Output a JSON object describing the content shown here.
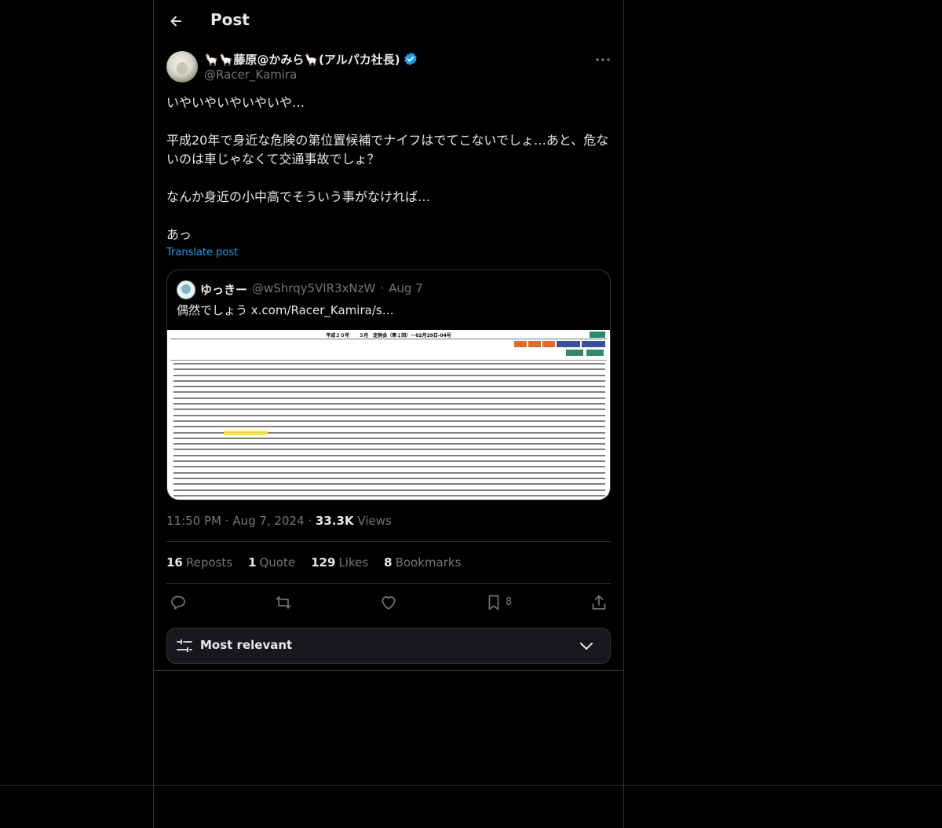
{
  "header": {
    "title": "Post"
  },
  "author": {
    "display_name": "🦙🦙藤原@かみら🦙(アルパカ社長)",
    "handle": "@Racer_Kamira",
    "verified": true
  },
  "tweet": {
    "text": "いやいやいやいやいや…\n\n平成20年で身近な危険の第位置候補でナイフはでてこないでしょ…あと、危ないのは車じゃなくて交通事故でしょ？\n\nなんか身近の小中高でそういう事がなければ…\n\nあっ",
    "translate_label": "Translate post"
  },
  "quote": {
    "name": "ゆっきー",
    "handle": "@wShrqy5VlR3xNzW",
    "separator": "·",
    "date": "Aug 7",
    "text": "偶然でしょう  x.com/Racer_Kamira/s…",
    "image": {
      "doc_title": "平成２０年　　３月　定例会（第１回）－02月29日-04号"
    }
  },
  "meta": {
    "time": "11:50 PM",
    "sep1": "·",
    "date": "Aug 7, 2024",
    "sep2": "·",
    "views_count": "33.3K",
    "views_label": "Views"
  },
  "stats": {
    "reposts_count": "16",
    "reposts_label": "Reposts",
    "quotes_count": "1",
    "quotes_label": "Quote",
    "likes_count": "129",
    "likes_label": "Likes",
    "bookmarks_count": "8",
    "bookmarks_label": "Bookmarks"
  },
  "actions": {
    "bookmark_count": "8"
  },
  "sort": {
    "label": "Most relevant"
  },
  "colors": {
    "accent": "#1d9bf0",
    "background": "#000000",
    "border": "#2f3336",
    "muted": "#71767b"
  }
}
